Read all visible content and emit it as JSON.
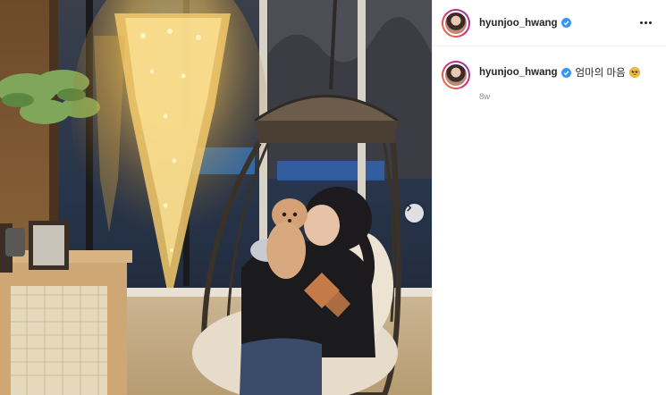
{
  "post": {
    "username": "hyunjoo_hwang",
    "caption_text": "엄마의 마음",
    "caption_emoji": "pleading-face",
    "time_ago": "8w"
  },
  "colors": {
    "verified_blue": "#3897f0",
    "secondary_text": "#8e8e8e",
    "avatar_ring": "#dd2a7b"
  },
  "icons": {
    "more": "more-options-icon",
    "verified": "verified-badge-icon",
    "next": "chevron-right-icon"
  }
}
